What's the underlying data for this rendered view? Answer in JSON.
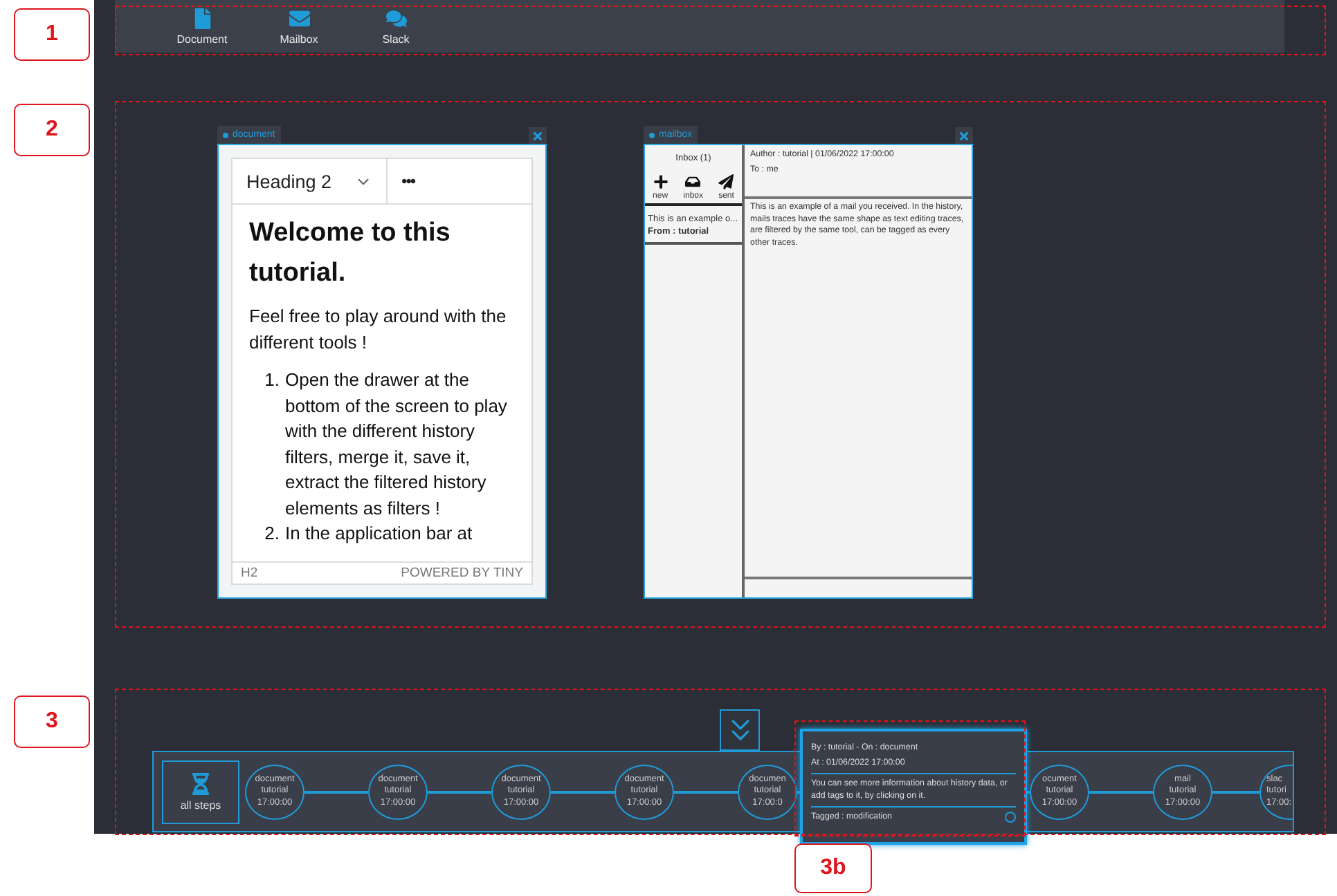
{
  "app_bar": {
    "items": [
      {
        "kind": "document",
        "label": "Document"
      },
      {
        "kind": "mailbox",
        "label": "Mailbox"
      },
      {
        "kind": "chat",
        "label": "Slack"
      }
    ]
  },
  "document_window": {
    "tab": "document",
    "toolbar": {
      "block_format": "Heading 2",
      "more": "•••"
    },
    "heading": "Welcome to this tutorial.",
    "paragraph": "Feel free to play around with the different tools !",
    "list": [
      {
        "marker": "1.",
        "text": "Open the drawer at the bottom of the screen to play with the different history filters, merge it, save it, extract the filtered history elements as filters !"
      },
      {
        "marker": "2.",
        "text": "In the application bar at"
      }
    ],
    "status_bar": {
      "element": "H2",
      "branding": "POWERED BY TINY"
    }
  },
  "mailbox_window": {
    "tab": "mailbox",
    "folder_title": "Inbox (1)",
    "actions": [
      {
        "kind": "new",
        "label": "new"
      },
      {
        "kind": "inbox",
        "label": "inbox"
      },
      {
        "kind": "sent",
        "label": "sent"
      }
    ],
    "messages": [
      {
        "preview": "This is an example o...",
        "from": "From : tutorial",
        "selected": false
      }
    ],
    "reader": {
      "author_line": "Author : tutorial | 01/06/2022 17:00:00",
      "to_line": "To : me",
      "body": "This is an example of a mail you received. In the history, mails traces have the same shape as text editing traces, are filtered by the same tool, can be tagged as every other traces."
    }
  },
  "timeline": {
    "all_steps": "all steps",
    "steps_left": [
      {
        "tool": "document",
        "user": "tutorial",
        "time": "17:00:00",
        "cut_off": false
      },
      {
        "tool": "document",
        "user": "tutorial",
        "time": "17:00:00",
        "cut_off": false
      },
      {
        "tool": "document",
        "user": "tutorial",
        "time": "17:00:00",
        "cut_off": false
      },
      {
        "tool": "document",
        "user": "tutorial",
        "time": "17:00:00",
        "cut_off": false
      },
      {
        "tool": "documen",
        "user": "tutorial",
        "time": "17:00:0",
        "cut_off": false
      }
    ],
    "hover_card": {
      "by_line": "By : tutorial - On : document",
      "at_line": "At : 01/06/2022 17:00:00",
      "hint": "You can see more information about history data, or add tags to it, by clicking on it.",
      "tags": "Tagged : modification"
    },
    "steps_right": [
      {
        "tool": "ocument",
        "user": "tutorial",
        "time": "17:00:00",
        "cut_off": false
      },
      {
        "tool": "mail",
        "user": "tutorial",
        "time": "17:00:00",
        "cut_off": false
      },
      {
        "tool": "slac",
        "user": "tutori",
        "time": "17:00:",
        "cut_off": true
      }
    ]
  },
  "annotations": {
    "labels": [
      "1",
      "2",
      "3",
      "3b"
    ]
  }
}
